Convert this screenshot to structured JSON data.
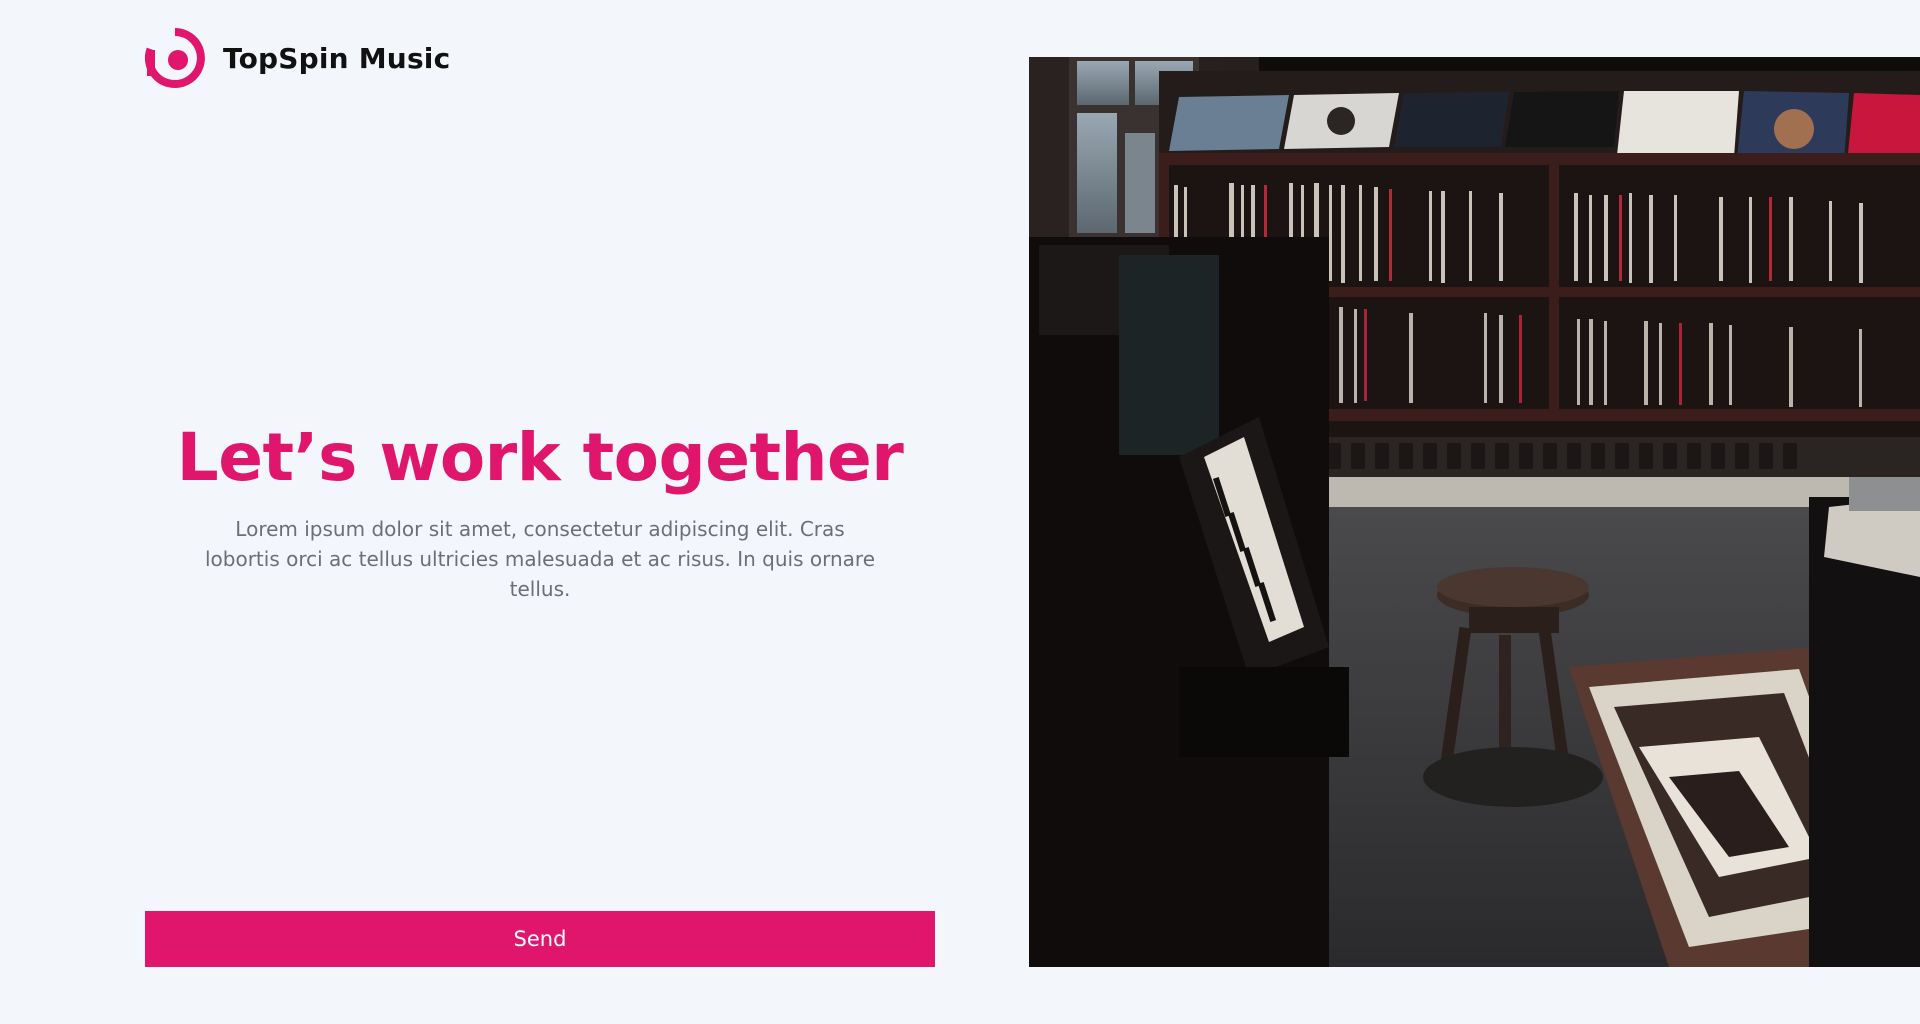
{
  "brand": {
    "name": "TopSpin Music",
    "logo_icon": "topspin-logo-icon",
    "accent_color": "#e0166d"
  },
  "hero": {
    "title": "Let’s work together",
    "text": "Lorem ipsum dolor sit amet, consectetur adipiscing elit. Cras lobortis orci ac tellus ultricies malesuada et ac risus. In quis ornare tellus."
  },
  "form": {
    "send_label": "Send"
  },
  "photo": {
    "icon": "record-store-photo"
  }
}
